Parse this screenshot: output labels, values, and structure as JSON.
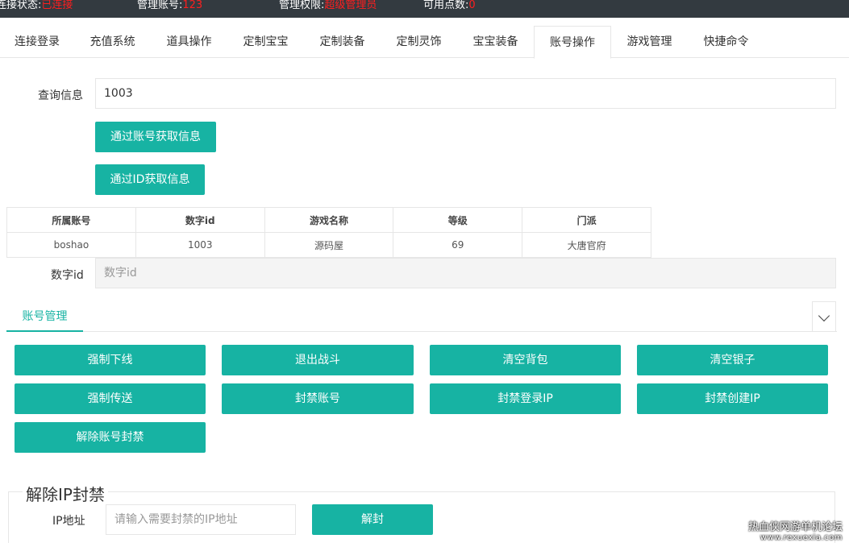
{
  "status_bar": {
    "connection_label": "连接状态:",
    "connection_value": "已连接",
    "account_label": "管理账号:",
    "account_value": "123",
    "permission_label": "管理权限:",
    "permission_value": "超级管理员",
    "points_label": "可用点数:",
    "points_value": "0"
  },
  "tabs": [
    {
      "label": "连接登录"
    },
    {
      "label": "充值系统"
    },
    {
      "label": "道具操作"
    },
    {
      "label": "定制宝宝"
    },
    {
      "label": "定制装备"
    },
    {
      "label": "定制灵饰"
    },
    {
      "label": "宝宝装备"
    },
    {
      "label": "账号操作",
      "active": true
    },
    {
      "label": "游戏管理"
    },
    {
      "label": "快捷命令"
    }
  ],
  "query": {
    "label": "查询信息",
    "value": "1003",
    "by_account_button": "通过账号获取信息",
    "by_id_button": "通过ID获取信息"
  },
  "result_table": {
    "headers": [
      "所属账号",
      "数字id",
      "游戏名称",
      "等级",
      "门派"
    ],
    "rows": [
      [
        "boshao",
        "1003",
        "源码屋",
        "69",
        "大唐官府"
      ]
    ]
  },
  "digit_id": {
    "label": "数字id",
    "placeholder": "数字id"
  },
  "account_management": {
    "tab_label": "账号管理",
    "buttons": [
      "强制下线",
      "退出战斗",
      "清空背包",
      "清空银子",
      "强制传送",
      "封禁账号",
      "封禁登录IP",
      "封禁创建IP",
      "解除账号封禁"
    ]
  },
  "unban_ip": {
    "legend": "解除IP封禁",
    "label": "IP地址",
    "placeholder": "请输入需要封禁的IP地址",
    "button": "解封"
  },
  "watermark": {
    "line1": "热血侠网游单机论坛",
    "line2": "www.rexuexia.com"
  },
  "colors": {
    "accent": "#17b3a3",
    "status_value": "#ff1e1e",
    "status_bar_bg": "#333a40"
  }
}
